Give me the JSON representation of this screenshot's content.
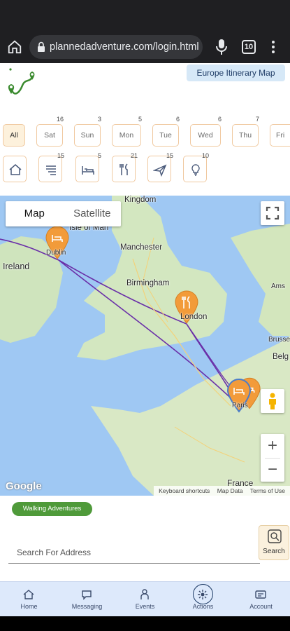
{
  "browser": {
    "url": "plannedadventure.com/login.html",
    "tab_count": "10"
  },
  "header": {
    "map_title": "Europe Itinerary Map"
  },
  "day_filters": [
    {
      "label": "All",
      "count": ""
    },
    {
      "label": "Sat",
      "count": "16"
    },
    {
      "label": "Sun",
      "count": "3"
    },
    {
      "label": "Mon",
      "count": "5"
    },
    {
      "label": "Tue",
      "count": "6"
    },
    {
      "label": "Wed",
      "count": "6"
    },
    {
      "label": "Thu",
      "count": "7"
    },
    {
      "label": "Fri",
      "count": ""
    }
  ],
  "category_filters": [
    {
      "icon": "home-icon",
      "count": ""
    },
    {
      "icon": "list-icon",
      "count": "15"
    },
    {
      "icon": "bed-icon",
      "count": "5"
    },
    {
      "icon": "dining-icon",
      "count": "21"
    },
    {
      "icon": "plane-icon",
      "count": "15"
    },
    {
      "icon": "lightbulb-icon",
      "count": "10"
    }
  ],
  "map": {
    "type_map": "Map",
    "type_satellite": "Satellite",
    "labels": {
      "kingdom": "Kingdom",
      "isle_of_man": "Isle of Man",
      "ireland": "Ireland",
      "manchester": "Manchester",
      "birmingham": "Birmingham",
      "london": "London",
      "dublin": "Dublin",
      "paris": "Paris",
      "ams": "Ams",
      "bru": "Brusse",
      "belg": "Belg",
      "france": "France"
    },
    "google": "Google",
    "attribution": [
      "Keyboard shortcuts",
      "Map Data",
      "Terms of Use"
    ],
    "zoom_in": "+",
    "zoom_out": "−"
  },
  "walking_badge": "Walking Adventures",
  "search": {
    "placeholder": "Search For Address",
    "button_label": "Search"
  },
  "bottom_nav": [
    {
      "label": "Home",
      "icon": "home-icon"
    },
    {
      "label": "Messaging",
      "icon": "chat-icon"
    },
    {
      "label": "Events",
      "icon": "events-icon"
    },
    {
      "label": "Actions",
      "icon": "actions-icon"
    },
    {
      "label": "Account",
      "icon": "account-icon"
    }
  ],
  "colors": {
    "accent": "#f0c9a0",
    "map_pin": "#f29b3a",
    "route": "#6a2fa8",
    "nav_bg": "#dde9fb",
    "walking_green": "#4f9a3a"
  }
}
